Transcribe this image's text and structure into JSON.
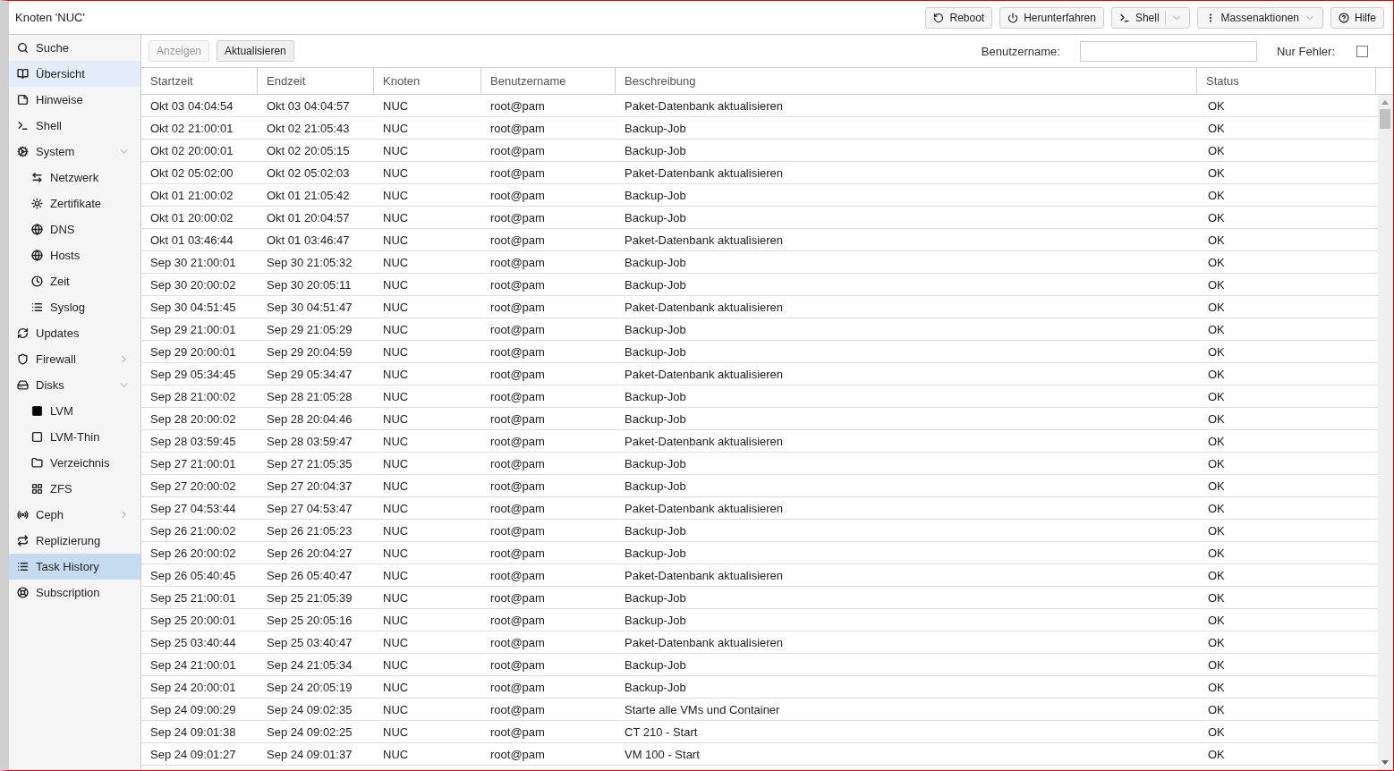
{
  "window": {
    "title": "Knoten 'NUC'"
  },
  "toolbar": {
    "buttons": [
      {
        "label": "Reboot",
        "kind": "plain"
      },
      {
        "label": "Herunterfahren",
        "kind": "plain"
      },
      {
        "label": "Shell",
        "kind": "split"
      },
      {
        "label": "Massenaktionen",
        "kind": "menu"
      },
      {
        "label": "Hilfe",
        "kind": "plain"
      }
    ]
  },
  "sidebar": {
    "items": [
      {
        "label": "Suche",
        "selected": false,
        "highlighted": false
      },
      {
        "label": "Übersicht",
        "selected": false,
        "highlighted": true
      },
      {
        "label": "Hinweise",
        "selected": false,
        "highlighted": false
      },
      {
        "label": "Shell",
        "selected": false,
        "highlighted": false
      },
      {
        "label": "System",
        "selected": false,
        "highlighted": false,
        "expanded": true,
        "children": [
          {
            "label": "Netzwerk",
            "selected": false,
            "highlighted": false
          },
          {
            "label": "Zertifikate",
            "selected": false,
            "highlighted": false
          },
          {
            "label": "DNS",
            "selected": false,
            "highlighted": false
          },
          {
            "label": "Hosts",
            "selected": false,
            "highlighted": false
          },
          {
            "label": "Zeit",
            "selected": false,
            "highlighted": false
          },
          {
            "label": "Syslog",
            "selected": false,
            "highlighted": false
          }
        ]
      },
      {
        "label": "Updates",
        "selected": false,
        "highlighted": false
      },
      {
        "label": "Firewall",
        "selected": false,
        "highlighted": false,
        "expanded": false
      },
      {
        "label": "Disks",
        "selected": false,
        "highlighted": false,
        "expanded": true,
        "children": [
          {
            "label": "LVM",
            "selected": false,
            "highlighted": false
          },
          {
            "label": "LVM-Thin",
            "selected": false,
            "highlighted": false
          },
          {
            "label": "Verzeichnis",
            "selected": false,
            "highlighted": false
          },
          {
            "label": "ZFS",
            "selected": false,
            "highlighted": false
          }
        ]
      },
      {
        "label": "Ceph",
        "selected": false,
        "highlighted": false,
        "expanded": false
      },
      {
        "label": "Replizierung",
        "selected": false,
        "highlighted": false
      },
      {
        "label": "Task History",
        "selected": true,
        "highlighted": false
      },
      {
        "label": "Subscription",
        "selected": false,
        "highlighted": false
      }
    ]
  },
  "filter_bar": {
    "buttons": [
      {
        "label": "Anzeigen",
        "disabled": true
      },
      {
        "label": "Aktualisieren",
        "disabled": false
      }
    ],
    "username": {
      "label": "Benutzername:"
    },
    "errors_only": {
      "label": "Nur Fehler:",
      "checked": false
    }
  },
  "table": {
    "columns": [
      "Startzeit",
      "Endzeit",
      "Knoten",
      "Benutzername",
      "Beschreibung",
      "Status"
    ],
    "rows": [
      [
        "Okt 03 04:04:54",
        "Okt 03 04:04:57",
        "NUC",
        "root@pam",
        "Paket-Datenbank aktualisieren",
        "OK"
      ],
      [
        "Okt 02 21:00:01",
        "Okt 02 21:05:43",
        "NUC",
        "root@pam",
        "Backup-Job",
        "OK"
      ],
      [
        "Okt 02 20:00:01",
        "Okt 02 20:05:15",
        "NUC",
        "root@pam",
        "Backup-Job",
        "OK"
      ],
      [
        "Okt 02 05:02:00",
        "Okt 02 05:02:03",
        "NUC",
        "root@pam",
        "Paket-Datenbank aktualisieren",
        "OK"
      ],
      [
        "Okt 01 21:00:02",
        "Okt 01 21:05:42",
        "NUC",
        "root@pam",
        "Backup-Job",
        "OK"
      ],
      [
        "Okt 01 20:00:02",
        "Okt 01 20:04:57",
        "NUC",
        "root@pam",
        "Backup-Job",
        "OK"
      ],
      [
        "Okt 01 03:46:44",
        "Okt 01 03:46:47",
        "NUC",
        "root@pam",
        "Paket-Datenbank aktualisieren",
        "OK"
      ],
      [
        "Sep 30 21:00:01",
        "Sep 30 21:05:32",
        "NUC",
        "root@pam",
        "Backup-Job",
        "OK"
      ],
      [
        "Sep 30 20:00:02",
        "Sep 30 20:05:11",
        "NUC",
        "root@pam",
        "Backup-Job",
        "OK"
      ],
      [
        "Sep 30 04:51:45",
        "Sep 30 04:51:47",
        "NUC",
        "root@pam",
        "Paket-Datenbank aktualisieren",
        "OK"
      ],
      [
        "Sep 29 21:00:01",
        "Sep 29 21:05:29",
        "NUC",
        "root@pam",
        "Backup-Job",
        "OK"
      ],
      [
        "Sep 29 20:00:01",
        "Sep 29 20:04:59",
        "NUC",
        "root@pam",
        "Backup-Job",
        "OK"
      ],
      [
        "Sep 29 05:34:45",
        "Sep 29 05:34:47",
        "NUC",
        "root@pam",
        "Paket-Datenbank aktualisieren",
        "OK"
      ],
      [
        "Sep 28 21:00:02",
        "Sep 28 21:05:28",
        "NUC",
        "root@pam",
        "Backup-Job",
        "OK"
      ],
      [
        "Sep 28 20:00:02",
        "Sep 28 20:04:46",
        "NUC",
        "root@pam",
        "Backup-Job",
        "OK"
      ],
      [
        "Sep 28 03:59:45",
        "Sep 28 03:59:47",
        "NUC",
        "root@pam",
        "Paket-Datenbank aktualisieren",
        "OK"
      ],
      [
        "Sep 27 21:00:01",
        "Sep 27 21:05:35",
        "NUC",
        "root@pam",
        "Backup-Job",
        "OK"
      ],
      [
        "Sep 27 20:00:02",
        "Sep 27 20:04:37",
        "NUC",
        "root@pam",
        "Backup-Job",
        "OK"
      ],
      [
        "Sep 27 04:53:44",
        "Sep 27 04:53:47",
        "NUC",
        "root@pam",
        "Paket-Datenbank aktualisieren",
        "OK"
      ],
      [
        "Sep 26 21:00:02",
        "Sep 26 21:05:23",
        "NUC",
        "root@pam",
        "Backup-Job",
        "OK"
      ],
      [
        "Sep 26 20:00:02",
        "Sep 26 20:04:27",
        "NUC",
        "root@pam",
        "Backup-Job",
        "OK"
      ],
      [
        "Sep 26 05:40:45",
        "Sep 26 05:40:47",
        "NUC",
        "root@pam",
        "Paket-Datenbank aktualisieren",
        "OK"
      ],
      [
        "Sep 25 21:00:01",
        "Sep 25 21:05:39",
        "NUC",
        "root@pam",
        "Backup-Job",
        "OK"
      ],
      [
        "Sep 25 20:00:01",
        "Sep 25 20:05:16",
        "NUC",
        "root@pam",
        "Backup-Job",
        "OK"
      ],
      [
        "Sep 25 03:40:44",
        "Sep 25 03:40:47",
        "NUC",
        "root@pam",
        "Paket-Datenbank aktualisieren",
        "OK"
      ],
      [
        "Sep 24 21:00:01",
        "Sep 24 21:05:34",
        "NUC",
        "root@pam",
        "Backup-Job",
        "OK"
      ],
      [
        "Sep 24 20:00:01",
        "Sep 24 20:05:19",
        "NUC",
        "root@pam",
        "Backup-Job",
        "OK"
      ],
      [
        "Sep 24 09:00:29",
        "Sep 24 09:02:35",
        "NUC",
        "root@pam",
        "Starte alle VMs und Container",
        "OK"
      ],
      [
        "Sep 24 09:01:38",
        "Sep 24 09:02:25",
        "NUC",
        "root@pam",
        "CT 210 - Start",
        "OK"
      ],
      [
        "Sep 24 09:01:27",
        "Sep 24 09:01:37",
        "NUC",
        "root@pam",
        "VM 100 - Start",
        "OK"
      ]
    ]
  }
}
